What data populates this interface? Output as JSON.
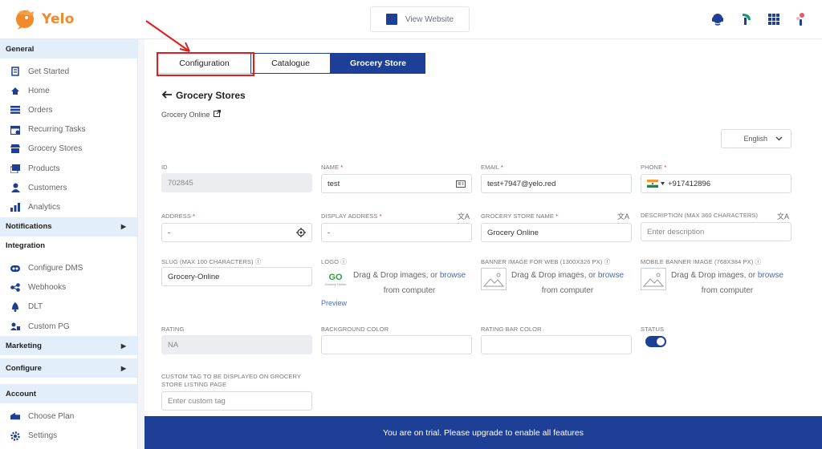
{
  "brand": {
    "name": "Yelo",
    "color": "#f08a2c"
  },
  "topbar": {
    "view_website": "View Website",
    "icons": [
      "support-icon",
      "leaf-icon",
      "apps-grid-icon",
      "notifications-icon"
    ]
  },
  "sidebar": {
    "general": "General",
    "general_items": [
      {
        "label": "Get Started",
        "icon": "checklist-icon"
      },
      {
        "label": "Home",
        "icon": "home-icon"
      },
      {
        "label": "Orders",
        "icon": "orders-icon"
      },
      {
        "label": "Recurring Tasks",
        "icon": "calendar-icon"
      },
      {
        "label": "Grocery Stores",
        "icon": "store-icon"
      },
      {
        "label": "Products",
        "icon": "products-icon"
      },
      {
        "label": "Customers",
        "icon": "customers-icon"
      },
      {
        "label": "Analytics",
        "icon": "analytics-icon"
      }
    ],
    "notifications": "Notifications",
    "integration": "Integration",
    "integration_items": [
      {
        "label": "Configure DMS",
        "icon": "dms-icon"
      },
      {
        "label": "Webhooks",
        "icon": "webhooks-icon"
      },
      {
        "label": "DLT",
        "icon": "bell-icon"
      },
      {
        "label": "Custom PG",
        "icon": "payment-icon"
      }
    ],
    "marketing": "Marketing",
    "configure": "Configure",
    "account": "Account",
    "account_items": [
      {
        "label": "Choose Plan",
        "icon": "plan-icon"
      },
      {
        "label": "Settings",
        "icon": "settings-icon"
      }
    ]
  },
  "tabs": {
    "configuration": "Configuration",
    "catalogue": "Catalogue",
    "grocery_store": "Grocery Store",
    "active": "Grocery Store"
  },
  "page": {
    "back_title": "Grocery Stores",
    "store_link": "Grocery Online",
    "language": "English"
  },
  "form": {
    "id": {
      "label": "ID",
      "value": "702845"
    },
    "name": {
      "label": "NAME",
      "value": "test"
    },
    "email": {
      "label": "EMAIL",
      "value": "test+7947@yelo.red"
    },
    "phone": {
      "label": "PHONE",
      "value": "+917412896",
      "flag": "India"
    },
    "address": {
      "label": "ADDRESS",
      "value": "-"
    },
    "display_address": {
      "label": "DISPLAY ADDRESS",
      "value": "-"
    },
    "store_name": {
      "label": "GROCERY STORE NAME",
      "value": "Grocery Online"
    },
    "description": {
      "label": "DESCRIPTION (MAX 360 CHARACTERS)",
      "placeholder": "Enter description"
    },
    "slug": {
      "label": "SLUG (MAX 100 CHARACTERS)",
      "value": "Grocery-Online"
    },
    "logo": {
      "label": "LOGO",
      "preview": "Preview",
      "logo_caption": "Grocery Online"
    },
    "banner_web": {
      "label": "BANNER IMAGE FOR WEB (1300X326 PX)"
    },
    "banner_mobile": {
      "label": "MOBILE BANNER IMAGE (768X384 PX)"
    },
    "dropzone": {
      "text": "Drag & Drop images, or",
      "browse": "browse",
      "from": "from computer"
    },
    "rating": {
      "label": "RATING",
      "value": "NA"
    },
    "background_color": {
      "label": "BACKGROUND COLOR"
    },
    "rating_bar_color": {
      "label": "RATING BAR COLOR"
    },
    "status": {
      "label": "STATUS",
      "enabled": true
    },
    "custom_tag": {
      "label": "CUSTOM TAG TO BE DISPLAYED ON GROCERY STORE LISTING PAGE",
      "placeholder": "Enter custom tag"
    }
  },
  "footer_banner": "You are on trial. Please upgrade to enable all features",
  "colors": {
    "primary": "#1d3f96",
    "highlight": "#e01e1e",
    "sidebar_header": "#e3eefb"
  }
}
